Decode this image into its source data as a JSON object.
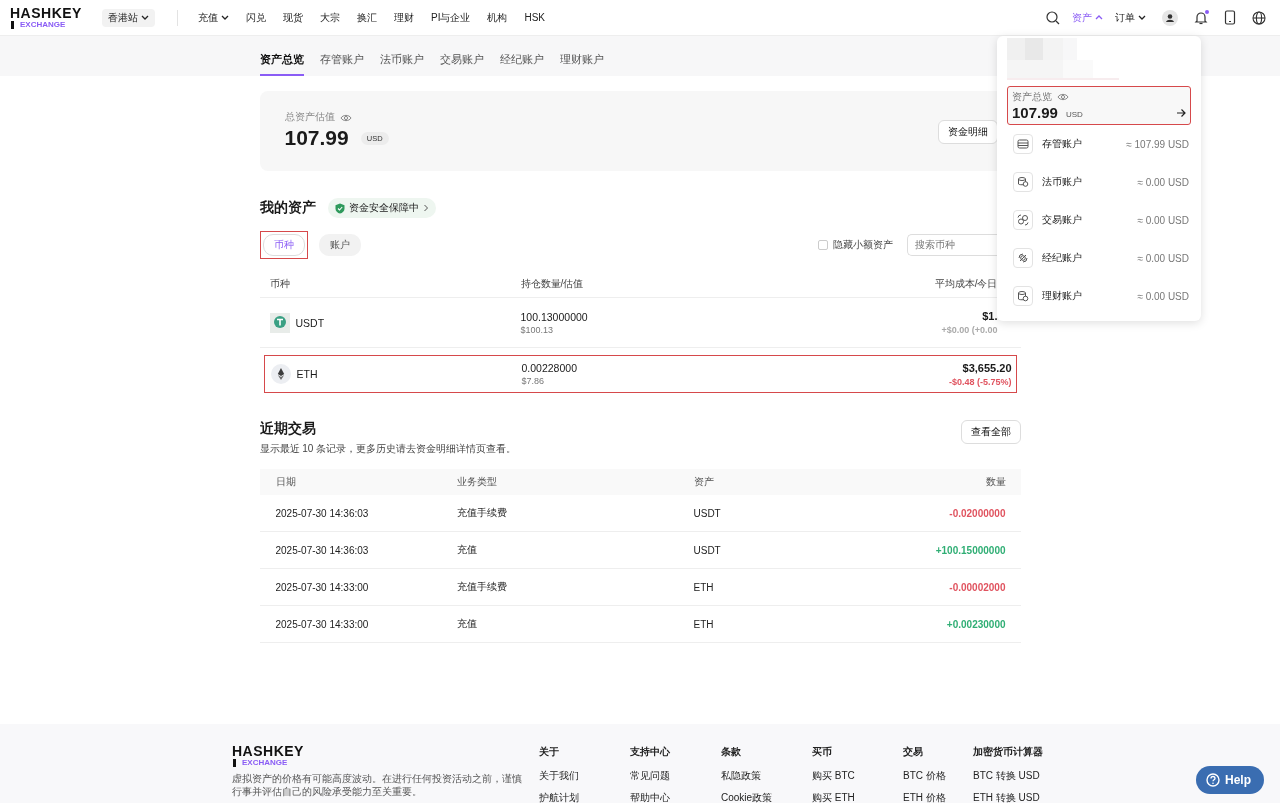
{
  "header": {
    "logo_top": "HASHKEY",
    "logo_bottom": "EXCHANGE",
    "site": "香港站",
    "nav": [
      {
        "label": "充值",
        "dropdown": true
      },
      {
        "label": "闪兑",
        "dropdown": false
      },
      {
        "label": "现货",
        "dropdown": false
      },
      {
        "label": "大宗",
        "dropdown": false
      },
      {
        "label": "换汇",
        "dropdown": false
      },
      {
        "label": "理财",
        "dropdown": false
      },
      {
        "label": "PI与企业",
        "dropdown": false
      },
      {
        "label": "机构",
        "dropdown": false
      },
      {
        "label": "HSK",
        "dropdown": false
      }
    ],
    "menus": [
      {
        "label": "资产",
        "expanded": true
      },
      {
        "label": "订单",
        "expanded": false
      }
    ],
    "notification_dot": true
  },
  "tabs": [
    {
      "label": "资产总览",
      "selected": true
    },
    {
      "label": "存管账户",
      "selected": false
    },
    {
      "label": "法币账户",
      "selected": false
    },
    {
      "label": "交易账户",
      "selected": false
    },
    {
      "label": "经纪账户",
      "selected": false
    },
    {
      "label": "理财账户",
      "selected": false
    }
  ],
  "summary": {
    "label": "总资产估值",
    "value": "107.99",
    "unit": "USD",
    "button": "资金明细"
  },
  "my_assets": {
    "title": "我的资产",
    "badge": "资金安全保障中",
    "view_tabs": [
      {
        "label": "币种",
        "selected": true,
        "highlighted": true
      },
      {
        "label": "账户",
        "selected": false,
        "highlighted": false
      }
    ],
    "hide_small": {
      "label": "隐藏小额资产",
      "checked": false
    },
    "search": {
      "placeholder": "搜索币种"
    },
    "columns": [
      "币种",
      "持仓数量/估值",
      "平均成本/今日"
    ],
    "rows": [
      {
        "coin": "USDT",
        "kind": "usdt",
        "amount": "100.13000000",
        "value": "$100.13",
        "cost": "$1.",
        "change": "+$0.00 (+0.00",
        "color": "#aaaaaa",
        "highlighted": false
      },
      {
        "coin": "ETH",
        "kind": "eth",
        "amount": "0.00228000",
        "value": "$7.86",
        "cost": "$3,655.20",
        "change": "-$0.48 (-5.75%)",
        "color": "#e0535f",
        "highlighted": true
      }
    ]
  },
  "recent": {
    "title": "近期交易",
    "subtitle": "显示最近 10 条记录，更多历史请去资金明细详情页查看。",
    "button": "查看全部",
    "columns": [
      "日期",
      "业务类型",
      "资产",
      "数量"
    ],
    "rows": [
      {
        "date": "2025-07-30 14:36:03",
        "type": "充值手续费",
        "asset": "USDT",
        "amount": "-0.02000000",
        "color": "#e0535f"
      },
      {
        "date": "2025-07-30 14:36:03",
        "type": "充值",
        "asset": "USDT",
        "amount": "+100.15000000",
        "color": "#2fae74"
      },
      {
        "date": "2025-07-30 14:33:00",
        "type": "充值手续费",
        "asset": "ETH",
        "amount": "-0.00002000",
        "color": "#e0535f"
      },
      {
        "date": "2025-07-30 14:33:00",
        "type": "充值",
        "asset": "ETH",
        "amount": "+0.00230000",
        "color": "#2fae74"
      }
    ]
  },
  "dropdown": {
    "summary": {
      "label": "资产总览",
      "value": "107.99",
      "unit": "USD",
      "highlighted": true
    },
    "accounts": [
      {
        "name": "存管账户",
        "value": "≈ 107.99 USD",
        "kind": "custody"
      },
      {
        "name": "法币账户",
        "value": "≈ 0.00 USD",
        "kind": "fiat"
      },
      {
        "name": "交易账户",
        "value": "≈ 0.00 USD",
        "kind": "trading"
      },
      {
        "name": "经纪账户",
        "value": "≈ 0.00 USD",
        "kind": "brokerage"
      },
      {
        "name": "理财账户",
        "value": "≈ 0.00 USD",
        "kind": "wealth"
      }
    ]
  },
  "footer": {
    "logo_top": "HASHKEY",
    "logo_bottom": "EXCHANGE",
    "disclaimer": "虚拟资产的价格有可能高度波动。在进行任何投资活动之前，谨慎行事并评估自己的风险承受能力至关重要。",
    "columns": [
      {
        "title": "关于",
        "links": [
          "关于我们",
          "护航计划"
        ]
      },
      {
        "title": "支持中心",
        "links": [
          "常见问题",
          "帮助中心"
        ]
      },
      {
        "title": "条款",
        "links": [
          "私隐政策",
          "Cookie政策"
        ]
      },
      {
        "title": "买币",
        "links": [
          "购买 BTC",
          "购买 ETH"
        ]
      },
      {
        "title": "交易",
        "links": [
          "BTC 价格",
          "ETH 价格"
        ]
      },
      {
        "title": "加密货币计算器",
        "links": [
          "BTC 转换 USD",
          "ETH 转换 USD"
        ]
      }
    ]
  },
  "help": "Help"
}
